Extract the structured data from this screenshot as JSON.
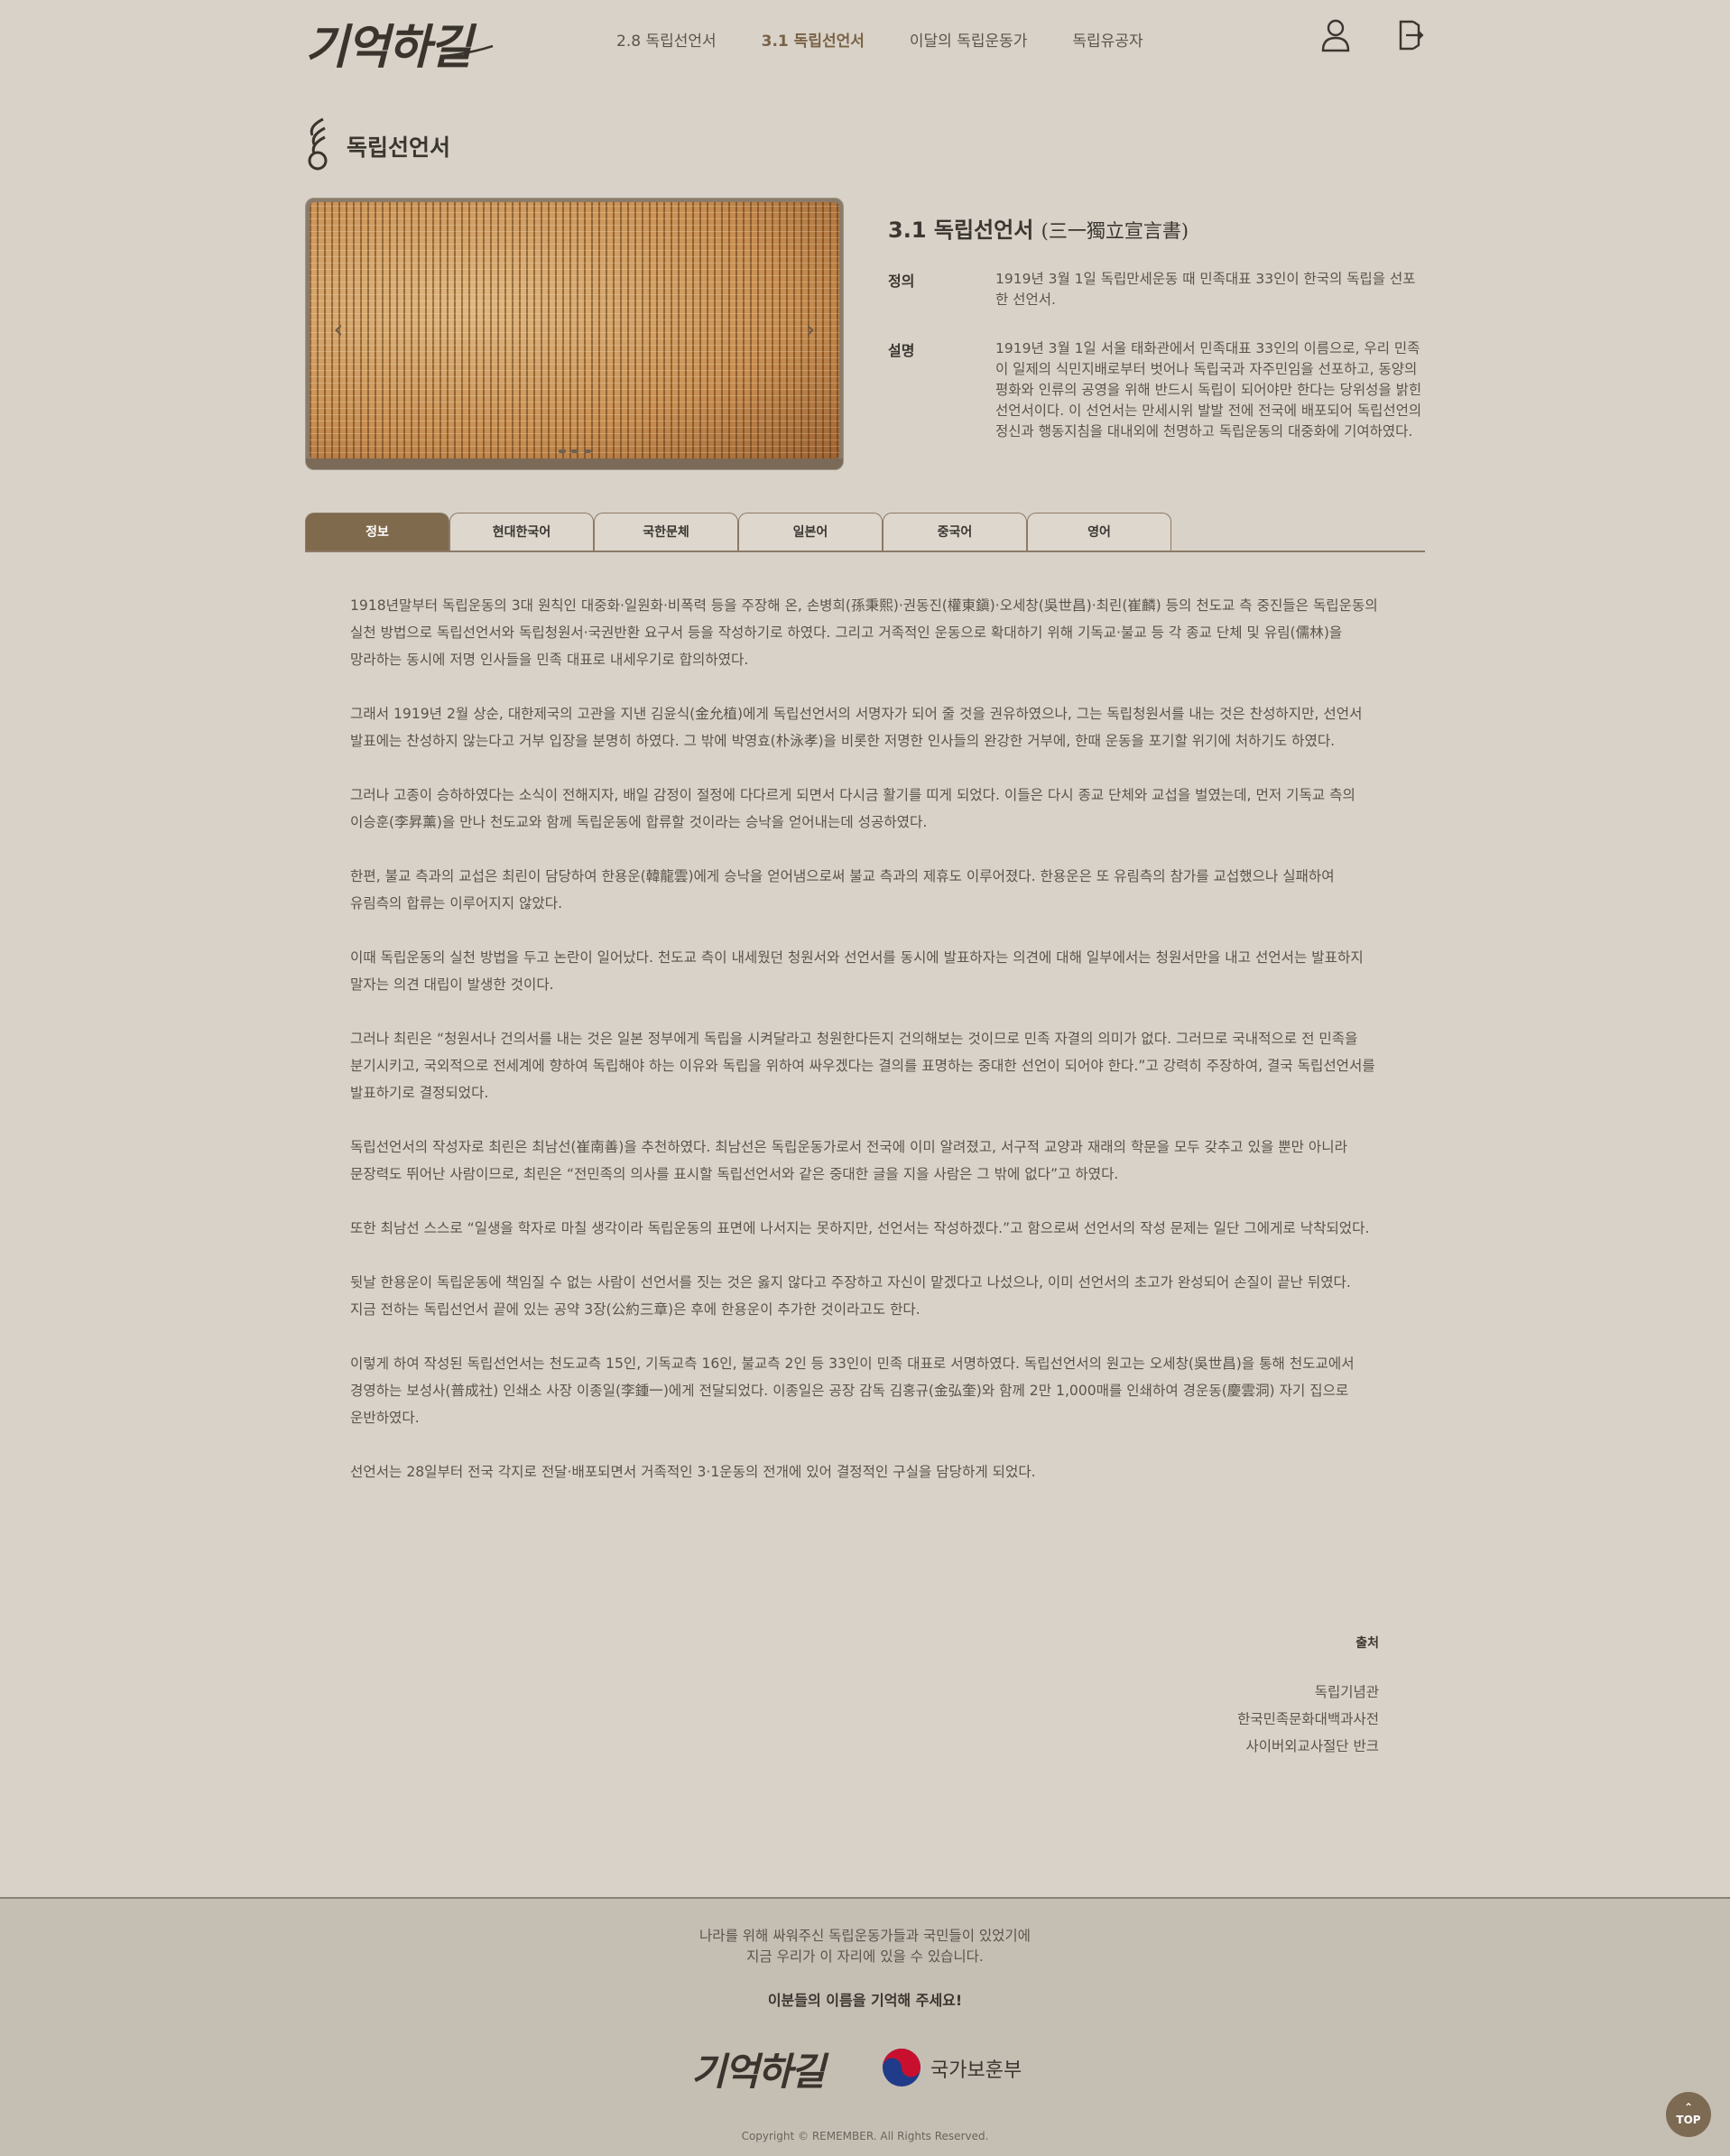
{
  "header": {
    "logo_text": "기억하길",
    "nav": [
      {
        "label": "2.8 독립선언서",
        "active": false
      },
      {
        "label": "3.1 독립선언서",
        "active": true
      },
      {
        "label": "이달의 독립운동가",
        "active": false
      },
      {
        "label": "독립유공자",
        "active": false
      }
    ],
    "icons": {
      "user": "user-icon",
      "logout": "logout-icon"
    }
  },
  "section": {
    "title": "독립선언서"
  },
  "carousel": {
    "prev_icon": "‹",
    "next_icon": "›",
    "dots": 3
  },
  "info": {
    "title": "3.1 독립선언서",
    "title_hanja": "(三一獨立宣言書)",
    "definition_label": "정의",
    "definition": "1919년 3월 1일 독립만세운동 때 민족대표 33인이 한국의 독립을 선포한 선언서.",
    "description_label": "설명",
    "description": "1919년 3월 1일 서울 태화관에서 민족대표 33인의 이름으로, 우리 민족이 일제의 식민지배로부터 벗어나 독립국과 자주민임을 선포하고, 동양의 평화와 인류의 공영을 위해 반드시 독립이 되어야만 한다는 당위성을 밝힌 선언서이다. 이 선언서는 만세시위 발발 전에 전국에 배포되어 독립선언의 정신과 행동지침을 대내외에 천명하고 독립운동의 대중화에 기여하였다."
  },
  "tabs": [
    "정보",
    "현대한국어",
    "국한문체",
    "일본어",
    "중국어",
    "영어"
  ],
  "active_tab": 0,
  "article": {
    "paragraphs": [
      "1918년말부터 독립운동의 3대 원칙인 대중화·일원화·비폭력 등을 주장해 온, 손병희(孫秉熙)·권동진(權東鎭)·오세창(吳世昌)·최린(崔麟) 등의 천도교 측 중진들은 독립운동의 실천 방법으로 독립선언서와 독립청원서·국권반환 요구서 등을 작성하기로 하였다. 그리고 거족적인 운동으로 확대하기 위해 기독교·불교 등 각 종교 단체 및 유림(儒林)을 망라하는 동시에 저명 인사들을 민족 대표로 내세우기로 합의하였다.",
      "그래서 1919년 2월 상순, 대한제국의 고관을 지낸 김윤식(金允植)에게 독립선언서의 서명자가 되어 줄 것을 권유하였으나, 그는 독립청원서를 내는 것은 찬성하지만, 선언서 발표에는 찬성하지 않는다고 거부 입장을 분명히 하였다. 그 밖에 박영효(朴泳孝)을 비롯한 저명한 인사들의 완강한 거부에, 한때 운동을 포기할 위기에 처하기도 하였다.",
      "그러나 고종이 승하하였다는 소식이 전해지자, 배일 감정이 절정에 다다르게 되면서 다시금 활기를 띠게 되었다. 이들은 다시 종교 단체와 교섭을 벌였는데, 먼저 기독교 측의 이승훈(李昇薰)을 만나 천도교와 함께 독립운동에 합류할 것이라는 승낙을 얻어내는데 성공하였다.",
      "한편, 불교 측과의 교섭은 최린이 담당하여 한용운(韓龍雲)에게 승낙을 얻어냄으로써 불교 측과의 제휴도 이루어졌다. 한용운은 또 유림측의 참가를 교섭했으나 실패하여 유림측의 합류는 이루어지지 않았다.",
      "이때 독립운동의 실천 방법을 두고 논란이 일어났다. 천도교 측이 내세웠던 청원서와 선언서를 동시에 발표하자는 의견에 대해 일부에서는 청원서만을 내고 선언서는 발표하지 말자는 의견 대립이 발생한 것이다.",
      "그러나 최린은 “청원서나 건의서를 내는 것은 일본 정부에게 독립을 시켜달라고 청원한다든지 건의해보는 것이므로 민족 자결의 의미가 없다. 그러므로 국내적으로 전 민족을 분기시키고, 국외적으로 전세계에 향하여 독립해야 하는 이유와 독립을 위하여 싸우겠다는 결의를 표명하는 중대한 선언이 되어야 한다.”고 강력히 주장하여, 결국 독립선언서를 발표하기로 결정되었다.",
      "독립선언서의 작성자로 최린은 최남선(崔南善)을 추천하였다. 최남선은 독립운동가로서 전국에 이미 알려졌고, 서구적 교양과 재래의 학문을 모두 갖추고 있을 뿐만 아니라 문장력도 뛰어난 사람이므로, 최린은 “전민족의 의사를 표시할 독립선언서와 같은 중대한 글을 지을 사람은 그 밖에 없다”고 하였다.",
      "또한 최남선 스스로 “일생을 학자로 마칠 생각이라 독립운동의 표면에 나서지는 못하지만, 선언서는 작성하겠다.”고 함으로써 선언서의 작성 문제는 일단 그에게로 낙착되었다.",
      "뒷날 한용운이 독립운동에 책임질 수 없는 사람이 선언서를 짓는 것은 옳지 않다고 주장하고 자신이 맡겠다고 나섰으나, 이미 선언서의 초고가 완성되어 손질이 끝난 뒤였다. 지금 전하는 독립선언서 끝에 있는 공약 3장(公約三章)은 후에 한용운이 추가한 것이라고도 한다.",
      "이렇게 하여 작성된 독립선언서는 천도교측 15인, 기독교측 16인, 불교측 2인 등 33인이 민족 대표로 서명하였다. 독립선언서의 원고는 오세창(吳世昌)을 통해 천도교에서 경영하는 보성사(普成社) 인쇄소 사장 이종일(李鍾一)에게 전달되었다. 이종일은 공장 감독 김홍규(金弘奎)와 함께 2만 1,000매를 인쇄하여 경운동(慶雲洞) 자기 집으로 운반하였다.",
      "선언서는 28일부터 전국 각지로 전달·배포되면서 거족적인 3·1운동의 전개에 있어 결정적인 구실을 담당하게 되었다."
    ]
  },
  "source": {
    "label": "출처",
    "items": [
      "독립기념관",
      "한국민족문화대백과사전",
      "사이버외교사절단 반크"
    ]
  },
  "footer": {
    "message_line1": "나라를 위해 싸워주신 독립운동가들과 국민들이 있었기에",
    "message_line2": "지금 우리가 이 자리에 있을 수 있습니다.",
    "strong": "이분들의 이름을 기억해 주세요!",
    "logo_text": "기억하길",
    "mpva_text": "국가보훈부",
    "copyright": "Copyright © REMEMBER. All Rights Reserved.",
    "top_label": "TOP"
  },
  "colors": {
    "background": "#d8d2c8",
    "accent": "#806a4d",
    "footer_bg": "#c5beb3",
    "text": "#5a544d"
  }
}
